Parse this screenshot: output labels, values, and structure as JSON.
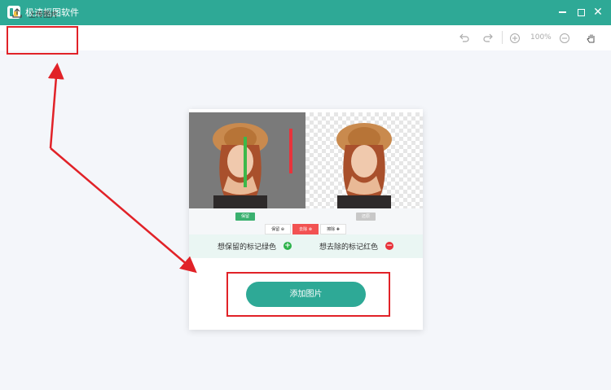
{
  "window": {
    "title": "极速抠图软件",
    "accent_color": "#2ea996"
  },
  "toolbar": {
    "upload_label": "上传图片",
    "upload_icon": "upload-icon",
    "undo_icon": "undo-icon",
    "redo_icon": "redo-icon",
    "zoom_in_icon": "zoom-in-icon",
    "zoom_level": "100%",
    "zoom_out_icon": "zoom-out-icon",
    "pan_icon": "hand-icon"
  },
  "demo": {
    "left_button": "保留",
    "right_button": "还原",
    "modes": [
      "保留 ⊕",
      "去除 ⊗",
      "擦除 ✚"
    ],
    "hint_keep": "想保留的标记绿色",
    "hint_remove": "想去除的标记红色",
    "keep_color": "#2db24a",
    "remove_color": "#e8333b"
  },
  "main": {
    "add_image_label": "添加图片"
  },
  "annotations": {
    "highlight_color": "#e12228"
  }
}
